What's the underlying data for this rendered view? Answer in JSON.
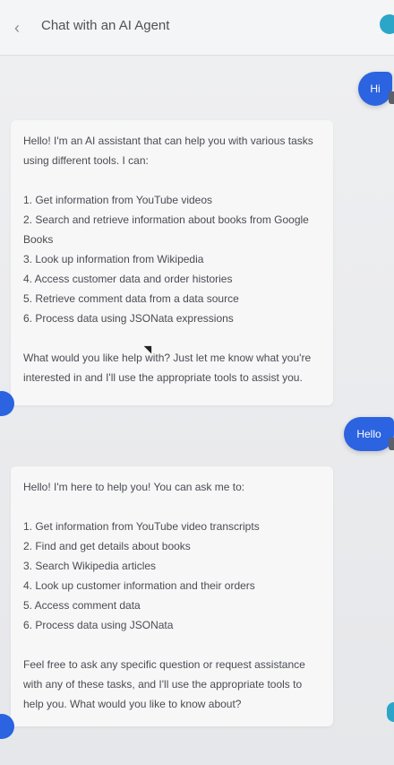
{
  "header": {
    "title": "Chat with an AI Agent"
  },
  "messages": [
    {
      "role": "user",
      "text": "Hi"
    },
    {
      "role": "assistant",
      "intro": "Hello! I'm an AI assistant that can help you with various tasks using different tools. I can:",
      "items": [
        "1. Get information from YouTube videos",
        "2. Search and retrieve information about books from Google Books",
        "3. Look up information from Wikipedia",
        "4. Access customer data and order histories",
        "5. Retrieve comment data from a data source",
        "6. Process data using JSONata expressions"
      ],
      "outro": "What would you like help with? Just let me know what you're interested in and I'll use the appropriate tools to assist you."
    },
    {
      "role": "user",
      "text": "Hello"
    },
    {
      "role": "assistant",
      "intro": "Hello! I'm here to help you! You can ask me to:",
      "items": [
        "1. Get information from YouTube video transcripts",
        "2. Find and get details about books",
        "3. Search Wikipedia articles",
        "4. Look up customer information and their orders",
        "5. Access comment data",
        "6. Process data using JSONata"
      ],
      "outro": "Feel free to ask any specific question or request assistance with any of these tasks, and I'll use the appropriate tools to help you. What would you like to know about?"
    }
  ]
}
